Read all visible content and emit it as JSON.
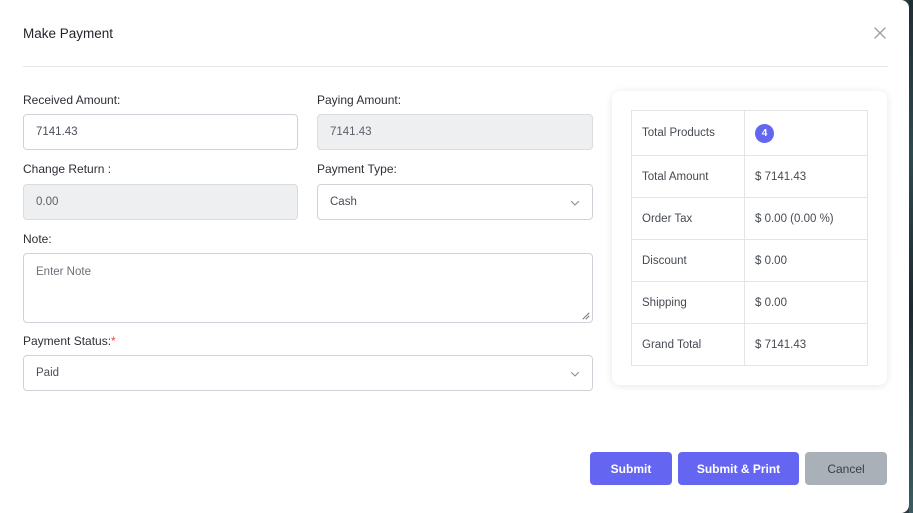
{
  "modal": {
    "title": "Make Payment"
  },
  "form": {
    "received_amount": {
      "label": "Received Amount:",
      "value": "7141.43"
    },
    "paying_amount": {
      "label": "Paying Amount:",
      "value": "7141.43"
    },
    "change_return": {
      "label": "Change Return :",
      "value": "0.00"
    },
    "payment_type": {
      "label": "Payment Type:",
      "value": "Cash"
    },
    "note": {
      "label": "Note:",
      "placeholder": "Enter Note"
    },
    "payment_status": {
      "label": "Payment Status:",
      "required_mark": "*",
      "value": "Paid"
    }
  },
  "summary": {
    "rows": [
      {
        "label": "Total Products",
        "value": "4"
      },
      {
        "label": "Total Amount",
        "value": "$ 7141.43"
      },
      {
        "label": "Order Tax",
        "value": "$ 0.00 (0.00 %)"
      },
      {
        "label": "Discount",
        "value": "$ 0.00"
      },
      {
        "label": "Shipping",
        "value": "$ 0.00"
      },
      {
        "label": "Grand Total",
        "value": "$ 7141.43"
      }
    ]
  },
  "actions": {
    "submit": "Submit",
    "submit_print": "Submit & Print",
    "cancel": "Cancel"
  },
  "colors": {
    "primary": "#6466f1",
    "secondary": "#a9b0b8",
    "badge": "#6366f1",
    "required": "#e5484d"
  },
  "icons": {
    "close": "close-icon",
    "dropdown": "chevron-down-icon"
  }
}
